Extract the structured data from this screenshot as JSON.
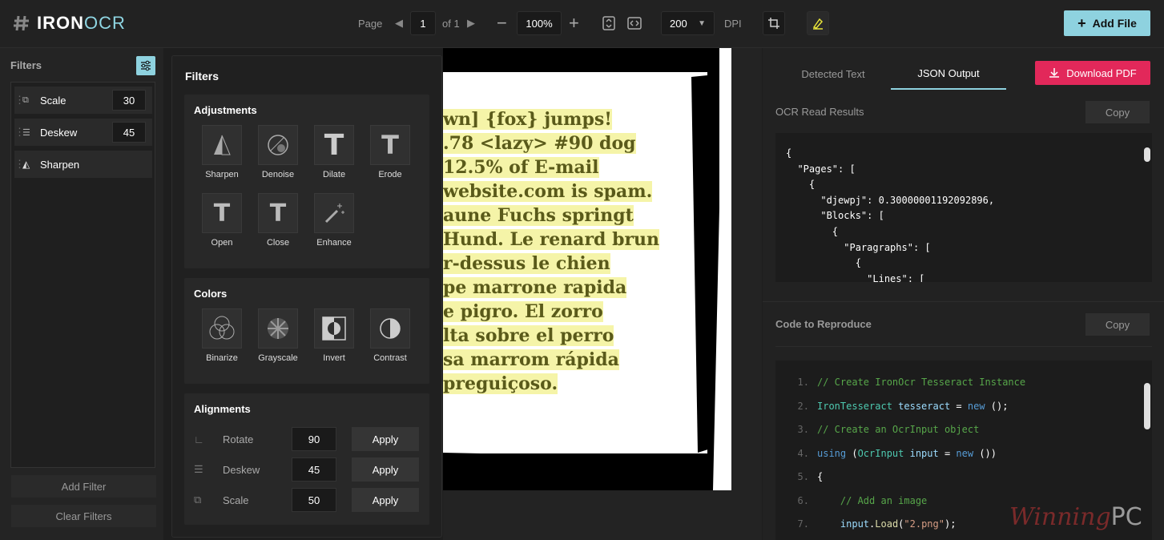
{
  "app": {
    "logo_left": "IRON",
    "logo_right": "OCR"
  },
  "toolbar": {
    "page_label": "Page",
    "page_value": "1",
    "page_of": "of 1",
    "zoom": "100%",
    "dpi_value": "200",
    "dpi_label": "DPI",
    "add_file": "Add File"
  },
  "filters_panel": {
    "title": "Filters",
    "items": [
      {
        "name": "Scale",
        "value": "30"
      },
      {
        "name": "Deskew",
        "value": "45"
      },
      {
        "name": "Sharpen",
        "value": ""
      }
    ],
    "add_filter": "Add Filter",
    "clear_filters": "Clear Filters"
  },
  "popup": {
    "title": "Filters",
    "adjustments": {
      "title": "Adjustments",
      "tools": [
        "Sharpen",
        "Denoise",
        "Dilate",
        "Erode",
        "Open",
        "Close",
        "Enhance"
      ]
    },
    "colors": {
      "title": "Colors",
      "tools": [
        "Binarize",
        "Grayscale",
        "Invert",
        "Contrast"
      ]
    },
    "alignments": {
      "title": "Alignments",
      "rows": [
        {
          "label": "Rotate",
          "value": "90",
          "button": "Apply"
        },
        {
          "label": "Deskew",
          "value": "45",
          "button": "Apply"
        },
        {
          "label": "Scale",
          "value": "50",
          "button": "Apply"
        }
      ]
    }
  },
  "document": {
    "lines": [
      "wn] {fox} jumps!",
      ".78 <lazy> #90 dog",
      " 12.5% of E-mail",
      "website.com is spam.",
      "aune Fuchs springt",
      "Hund. Le renard brun",
      "r-dessus le chien",
      "pe marrone rapida",
      "e pigro. El zorro",
      "lta sobre el perro",
      "sa marrom rápida",
      " preguiçoso."
    ]
  },
  "right_panel": {
    "tabs": [
      "Detected Text",
      "JSON Output"
    ],
    "active_tab": "JSON Output",
    "download": "Download PDF",
    "ocr_title": "OCR Read Results",
    "copy": "Copy",
    "code_title": "Code to Reproduce",
    "json_lines": [
      "{",
      "  \"Pages\": [",
      "    {",
      "      \"djewpj\": 0.30000001192092896,",
      "      \"Blocks\": [",
      "        {",
      "          \"Paragraphs\": [",
      "            {",
      "              \"Lines\": ["
    ],
    "code_lines": [
      {
        "n": "1.",
        "t": "// Create IronOcr Tesseract Instance"
      },
      {
        "n": "2.",
        "t": "IronTesseract tesseract = new ();"
      },
      {
        "n": "3.",
        "t": "// Create an OcrInput object"
      },
      {
        "n": "4.",
        "t": "using (OcrInput input = new ())"
      },
      {
        "n": "5.",
        "t": "{"
      },
      {
        "n": "6.",
        "t": "    // Add an image"
      },
      {
        "n": "7.",
        "t": "    input.Load(\"2.png\");"
      }
    ]
  },
  "watermark": {
    "left": "Winning",
    "right": "PC"
  },
  "colors": {
    "accent": "#8ed2df",
    "download": "#e2285a",
    "highlight": "#f5f4a8"
  }
}
